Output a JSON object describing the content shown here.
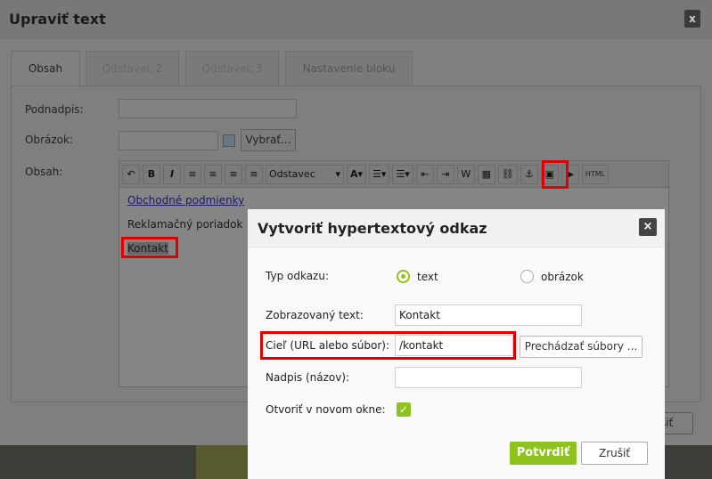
{
  "bg_dialog": {
    "title": "Upraviť text",
    "close": "x",
    "tabs": [
      {
        "label": "Obsah",
        "active": true
      },
      {
        "label": "Odstavec 2"
      },
      {
        "label": "Odstavec 3"
      },
      {
        "label": "Nastavenie bloku"
      }
    ],
    "fields": {
      "subtitle_label": "Podnadpis:",
      "image_label": "Obrázok:",
      "image_button": "Vybrať...",
      "content_label": "Obsah:"
    },
    "toolbar": {
      "format_select": "Odstavec",
      "html": "HTML"
    },
    "editor_lines": [
      "Obchodné podmienky",
      "Reklamačný poriadok",
      "Kontakt"
    ],
    "cancel_partial": "šiť"
  },
  "link_dialog": {
    "title": "Vytvoriť hypertextový odkaz",
    "close": "×",
    "type_label": "Typ odkazu:",
    "type_options": [
      {
        "label": "text",
        "selected": true
      },
      {
        "label": "obrázok",
        "selected": false
      }
    ],
    "display_text_label": "Zobrazovaný text:",
    "display_text_value": "Kontakt",
    "target_label": "Cieľ (URL alebo súbor):",
    "target_value": "/kontakt",
    "browse_button": "Prechádzať súbory ...",
    "title_label": "Nadpis (názov):",
    "title_value": "",
    "new_window_label": "Otvoriť v novom okne:",
    "new_window_checked": true,
    "confirm": "Potvrdiť",
    "cancel": "Zrušiť"
  },
  "colors": {
    "accent": "#8dc21f",
    "highlight": "#e00000"
  }
}
